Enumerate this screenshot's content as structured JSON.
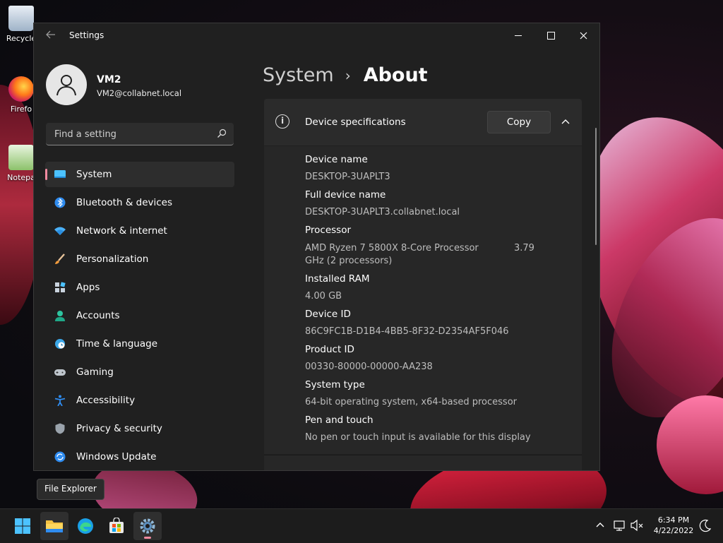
{
  "desktop": {
    "icons": [
      {
        "label": "Recycle",
        "icon": "recycle-bin-icon"
      },
      {
        "label": "Firefo",
        "icon": "firefox-icon"
      },
      {
        "label": "Notepa",
        "icon": "notepad-icon"
      }
    ]
  },
  "window": {
    "title": "Settings",
    "back_icon": "back-arrow-icon"
  },
  "profile": {
    "name": "VM2",
    "email": "VM2@collabnet.local"
  },
  "search": {
    "placeholder": "Find a setting"
  },
  "sidebar": {
    "accent": "#f38aa0",
    "items": [
      {
        "label": "System",
        "icon": "system-icon",
        "active": true
      },
      {
        "label": "Bluetooth & devices",
        "icon": "bluetooth-icon"
      },
      {
        "label": "Network & internet",
        "icon": "wifi-icon"
      },
      {
        "label": "Personalization",
        "icon": "brush-icon"
      },
      {
        "label": "Apps",
        "icon": "apps-icon"
      },
      {
        "label": "Accounts",
        "icon": "accounts-icon"
      },
      {
        "label": "Time & language",
        "icon": "globe-clock-icon"
      },
      {
        "label": "Gaming",
        "icon": "controller-icon"
      },
      {
        "label": "Accessibility",
        "icon": "accessibility-icon"
      },
      {
        "label": "Privacy & security",
        "icon": "shield-icon"
      },
      {
        "label": "Windows Update",
        "icon": "update-icon"
      }
    ]
  },
  "breadcrumb": {
    "parent": "System",
    "separator": "›",
    "current": "About"
  },
  "device_specs": {
    "title": "Device specifications",
    "copy_label": "Copy",
    "rows": [
      {
        "label": "Device name",
        "value": "DESKTOP-3UAPLT3"
      },
      {
        "label": "Full device name",
        "value": "DESKTOP-3UAPLT3.collabnet.local"
      },
      {
        "label": "Processor",
        "value_line1": "AMD Ryzen 7 5800X 8-Core Processor",
        "value_line1_right": "3.79",
        "value_line2": "GHz  (2 processors)"
      },
      {
        "label": "Installed RAM",
        "value": "4.00 GB"
      },
      {
        "label": "Device ID",
        "value": "86C9FC1B-D1B4-4BB5-8F32-D2354AF5F046"
      },
      {
        "label": "Product ID",
        "value": "00330-80000-00000-AA238"
      },
      {
        "label": "System type",
        "value": "64-bit operating system, x64-based processor"
      },
      {
        "label": "Pen and touch",
        "value": "No pen or touch input is available for this display"
      }
    ]
  },
  "tooltip": "File Explorer",
  "taskbar": {
    "apps": [
      {
        "name": "Start",
        "icon": "windows-start-icon"
      },
      {
        "name": "File Explorer",
        "icon": "folder-icon"
      },
      {
        "name": "Microsoft Edge",
        "icon": "edge-icon"
      },
      {
        "name": "Microsoft Store",
        "icon": "store-icon"
      },
      {
        "name": "Settings",
        "icon": "settings-gear-icon",
        "active": true
      }
    ],
    "tray_icons": [
      "chevron-up-icon",
      "network-icon",
      "volume-muted-icon",
      "focus-assist-icon"
    ],
    "time": "6:34 PM",
    "date": "4/22/2022"
  }
}
